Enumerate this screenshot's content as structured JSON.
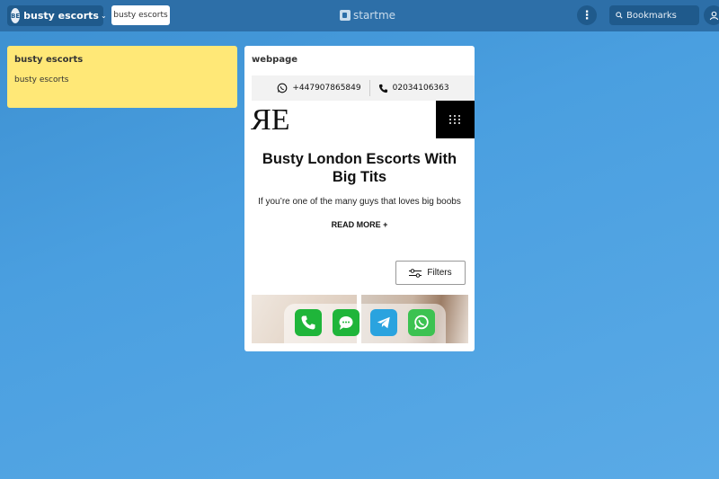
{
  "topbar": {
    "page_avatar": "BE",
    "page_name": "busty escorts",
    "tab_label": "busty escorts",
    "logo_text": "startme",
    "search_placeholder": "Bookmarks"
  },
  "note_widget": {
    "title": "busty escorts",
    "body": "busty escorts"
  },
  "web_widget": {
    "title": "webpage",
    "contacts": [
      {
        "icon": "whatsapp-icon",
        "number": "+447907865849"
      },
      {
        "icon": "phone-icon",
        "number": "02034106363"
      }
    ],
    "site_logo": "RE",
    "headline": "Busty London Escorts With Big Tits",
    "intro": "If you’re one of the many guys that loves big boobs",
    "read_more": "READ MORE +",
    "filters_label": "Filters",
    "dock_apps": [
      "phone-app-icon",
      "messages-app-icon",
      "telegram-app-icon",
      "whatsapp-app-icon"
    ]
  },
  "colors": {
    "topbar": "#2d6fa8",
    "background": "#4a9fe0",
    "note": "#ffe877",
    "phone_green": "#1fb53a",
    "telegram_blue": "#2aa3df",
    "whatsapp_green": "#3cc251"
  }
}
